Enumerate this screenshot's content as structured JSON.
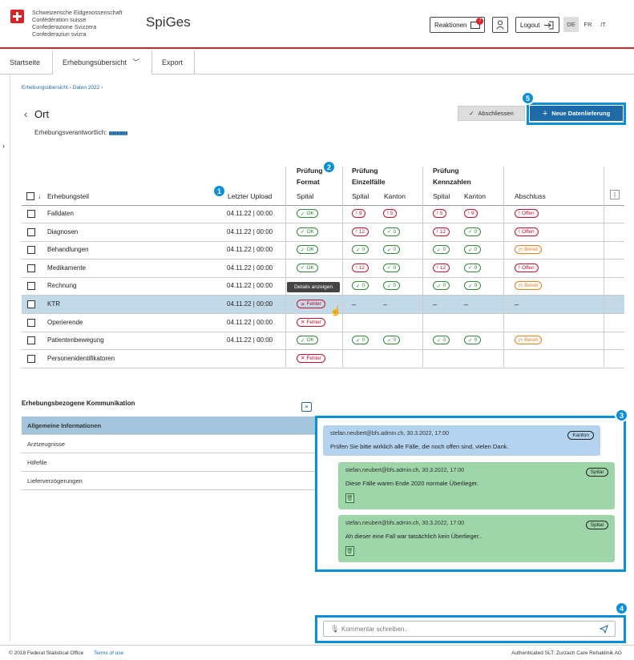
{
  "header": {
    "confederation": [
      "Schweizerische Eidgenossenschaft",
      "Confédération suisse",
      "Confederazione Svizzera",
      "Confederaziun svizra"
    ],
    "app_title": "SpiGes",
    "reactions_label": "Reaktionen",
    "reactions_count": "7",
    "logout_label": "Logout",
    "languages": [
      "DE",
      "FR",
      "IT"
    ],
    "active_language": "DE"
  },
  "nav": {
    "tabs": [
      "Startseite",
      "Erhebungsübersicht",
      "Export"
    ],
    "active": "Erhebungsübersicht"
  },
  "breadcrumb": [
    "Erhebungsübersicht",
    "Daten 2022"
  ],
  "page": {
    "title": "Ort",
    "responsible_label": "Erhebungsverantwortlich:",
    "responsible_value": "▮▮▮▮▮▮▮▮▮▮",
    "close_button": "Abschliessen",
    "new_delivery_button": "Neue Datenlieferung"
  },
  "table": {
    "group_headers": {
      "format": [
        "Prüfung",
        "Format"
      ],
      "cases": [
        "Prüfung",
        "Einzelfälle"
      ],
      "figures": [
        "Prüfung",
        "Kennzahlen"
      ]
    },
    "headers": {
      "part": "Erhebungsteil",
      "upload": "Letzter Upload",
      "spital": "Spital",
      "spital2": "Spital",
      "kanton": "Kanton",
      "spital3": "Spital",
      "kanton2": "Kanton",
      "closure": "Abschluss"
    },
    "rows": [
      {
        "name": "Falldaten",
        "upload": "04.11.22 | 00:00",
        "format": "OK",
        "c_spital": "9",
        "c_kanton": "5",
        "f_spital": "5",
        "f_kanton": "9",
        "closure": "Offen"
      },
      {
        "name": "Diagnosen",
        "upload": "04.11.22 | 00:00",
        "format": "OK",
        "c_spital": "12",
        "c_kanton": "0",
        "f_spital": "12",
        "f_kanton": "0",
        "closure": "Offen"
      },
      {
        "name": "Behandlungen",
        "upload": "04.11.22 | 00:00",
        "format": "OK",
        "c_spital": "0",
        "c_kanton": "0",
        "f_spital": "0",
        "f_kanton": "0",
        "closure": "Bereit"
      },
      {
        "name": "Medikamente",
        "upload": "04.11.22 | 00:00",
        "format": "OK",
        "c_spital": "12",
        "c_kanton": "0",
        "f_spital": "12",
        "f_kanton": "0",
        "closure": "Offen"
      },
      {
        "name": "Rechnung",
        "upload": "04.11.22 | 00:00",
        "format": "",
        "c_spital": "0",
        "c_kanton": "0",
        "f_spital": "0",
        "f_kanton": "0",
        "closure": "Bereit"
      },
      {
        "name": "KTR",
        "upload": "04.11.22 | 00:00",
        "format": "Fehler",
        "c_spital": "–",
        "c_kanton": "–",
        "f_spital": "–",
        "f_kanton": "–",
        "closure": "–"
      },
      {
        "name": "Operierende",
        "upload": "04.11.22 | 00:00",
        "format": "Fehler",
        "c_spital": "",
        "c_kanton": "",
        "f_spital": "",
        "f_kanton": "",
        "closure": ""
      },
      {
        "name": "Patientenbewegung",
        "upload": "04.11.22 | 00:00",
        "format": "OK",
        "c_spital": "0",
        "c_kanton": "0",
        "f_spital": "0",
        "f_kanton": "0",
        "closure": "Bereit"
      },
      {
        "name": "Personenidentifikatoren",
        "upload": "",
        "format": "Fehler",
        "c_spital": "",
        "c_kanton": "",
        "f_spital": "",
        "f_kanton": "",
        "closure": ""
      }
    ],
    "tooltip": "Details anzeigen"
  },
  "markers": [
    "1",
    "2",
    "3",
    "4",
    "5"
  ],
  "communication": {
    "title": "Erhebungsbezogene Kommunikation",
    "items": [
      "Allgemeine Informationen",
      "Arztzeugnisse",
      "Hilfefile",
      "Lieferverzögerungen"
    ],
    "messages": [
      {
        "meta": "stefan.neubert@bfs.admin.ch, 30.3.2022, 17:00",
        "text": "Prüfen Sie bitte wirklich alle Fälle, die noch offen sind, vielen Dank.",
        "tag": "Kanton"
      },
      {
        "meta": "stefan.neubert@bfs.admin.ch, 30.3.2022, 17:00",
        "text": "Diese Fälle waren Ende 2020 normale Überlieger.",
        "tag": "Spital"
      },
      {
        "meta": "stefan.neubert@bfs.admin.ch, 30.3.2022, 17:00",
        "text": "Ah dieser eine Fall war tatsächlich kein Überlieger..",
        "tag": "Spital"
      }
    ],
    "comment_placeholder": "Kommentar schreiben.."
  },
  "footer": {
    "copyright": "© 2018 Federal Statistical Office",
    "terms": "Terms of use",
    "auth": "Authenticated SLT: Zurzach Care Rehaklinik AG"
  },
  "colors": {
    "accent": "#1e6ba8",
    "focus": "#0b8fd9",
    "ok": "#2f8a37",
    "error": "#c8102e",
    "warn": "#e87d1e",
    "kanton_msg": "#b3d3ef",
    "spital_msg": "#9fd6a9"
  }
}
